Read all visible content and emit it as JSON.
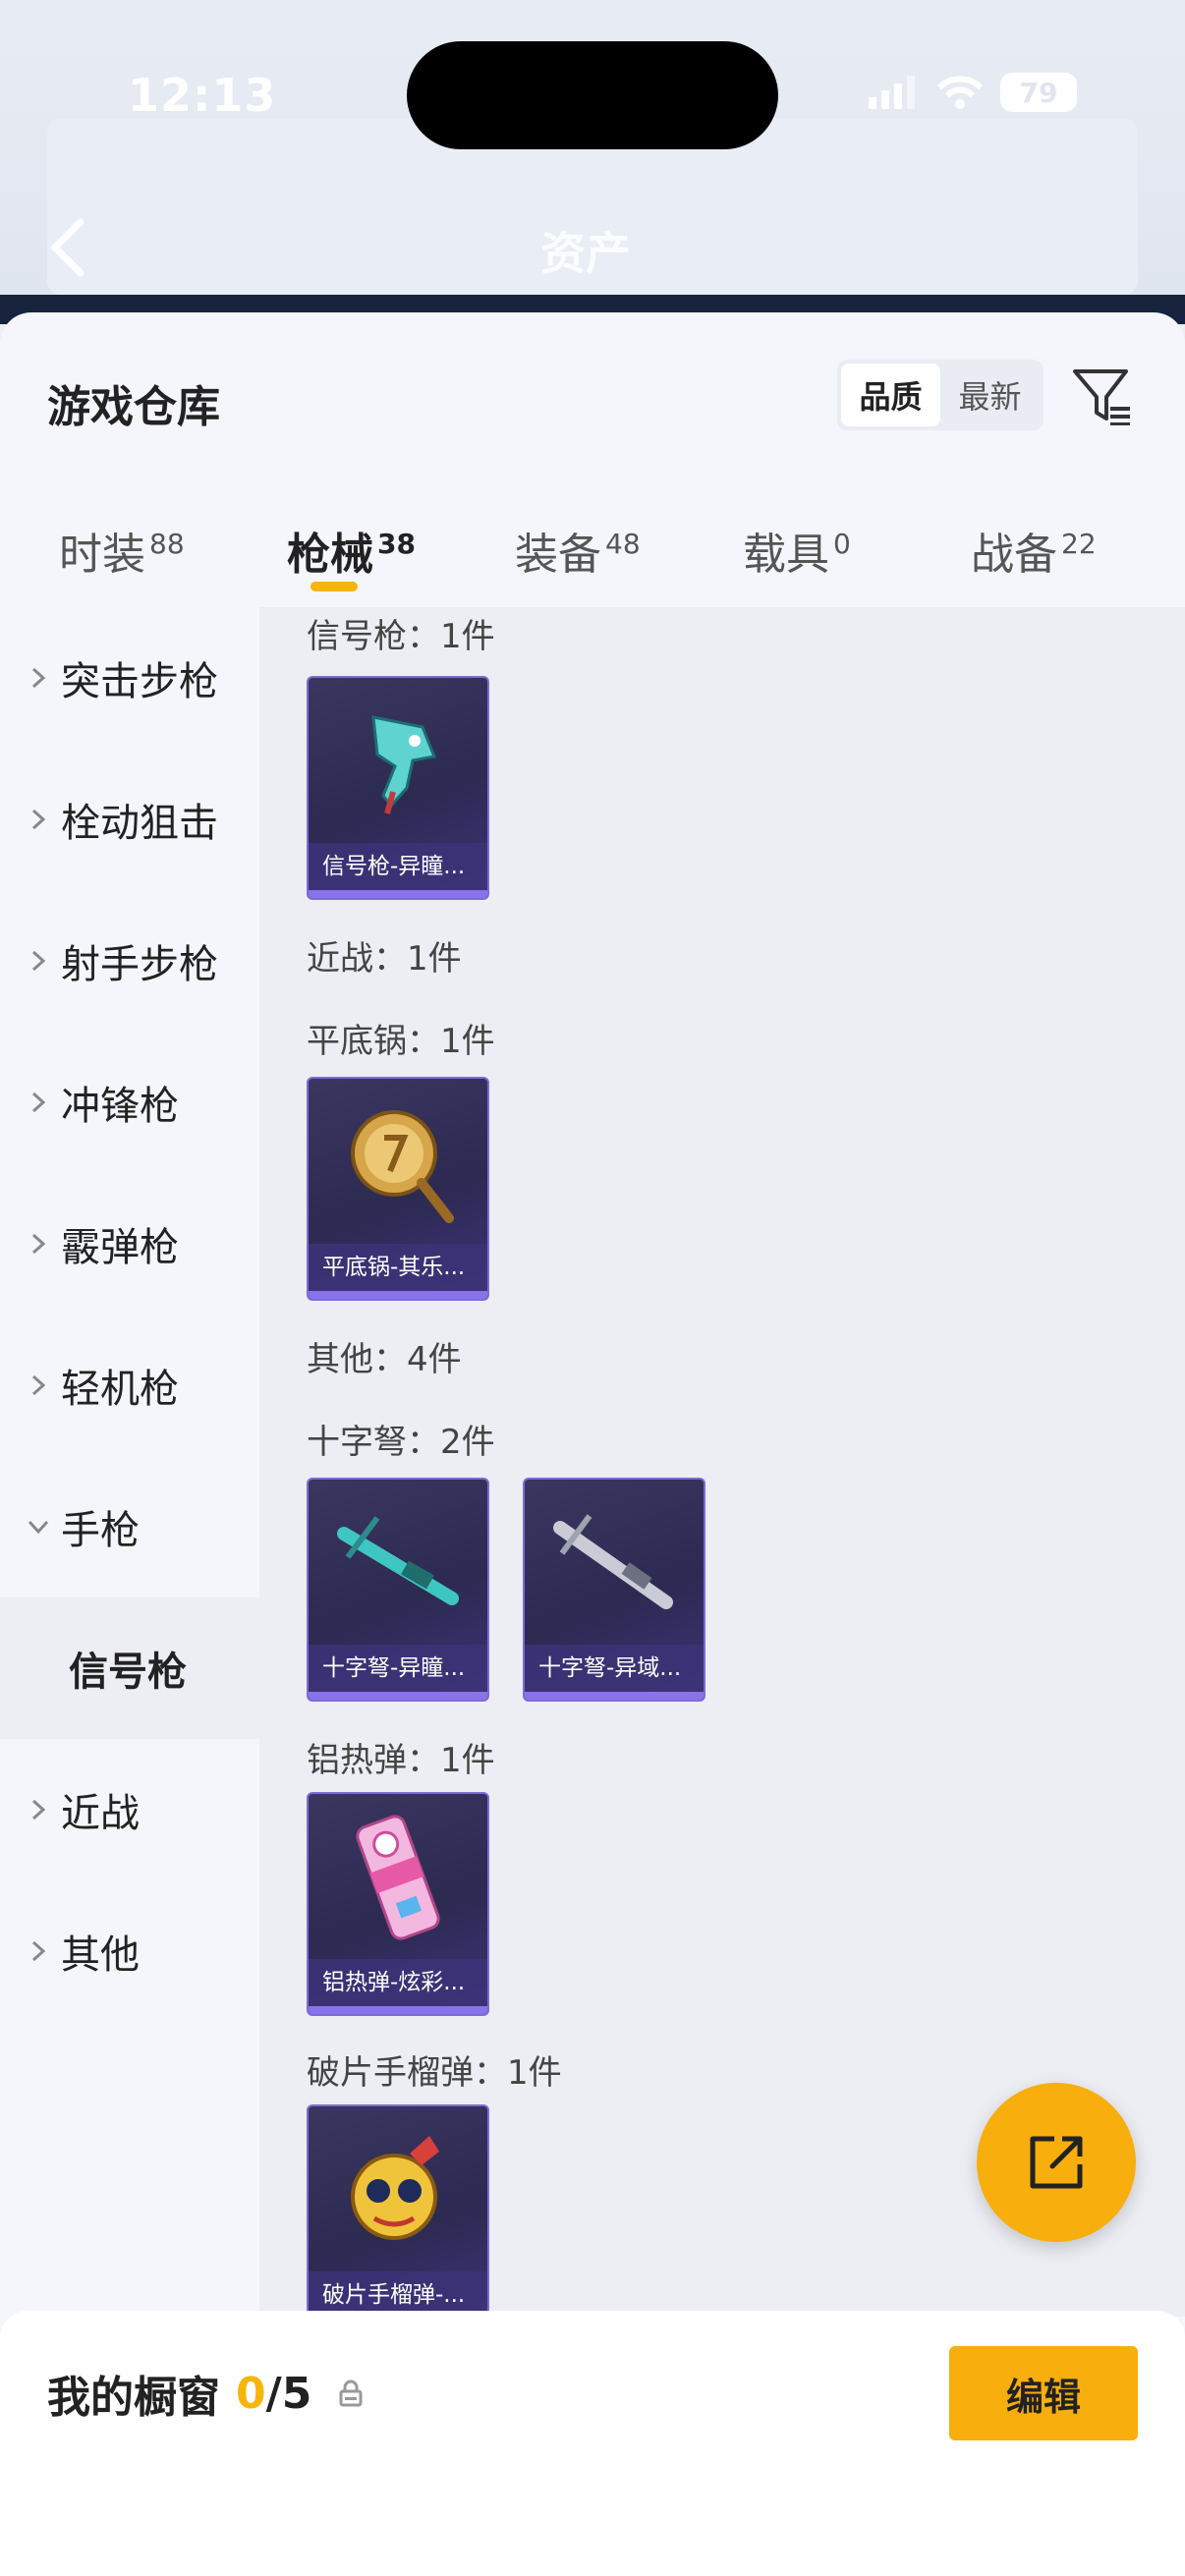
{
  "status_bar": {
    "time": "12:13",
    "battery": "79"
  },
  "header": {
    "title": "资产"
  },
  "panel": {
    "title": "游戏仓库",
    "sort": {
      "quality": "品质",
      "newest": "最新",
      "active": "quality"
    }
  },
  "tabs": [
    {
      "label": "时装",
      "count": "88"
    },
    {
      "label": "枪械",
      "count": "38",
      "active": true
    },
    {
      "label": "装备",
      "count": "48"
    },
    {
      "label": "载具",
      "count": "0"
    },
    {
      "label": "战备",
      "count": "22"
    }
  ],
  "categories": [
    {
      "label": "突击步枪"
    },
    {
      "label": "栓动狙击"
    },
    {
      "label": "射手步枪"
    },
    {
      "label": "冲锋枪"
    },
    {
      "label": "霰弹枪"
    },
    {
      "label": "轻机枪"
    },
    {
      "label": "手枪",
      "expanded": true
    },
    {
      "label": "信号枪",
      "sub": true,
      "selected": true
    },
    {
      "label": "近战"
    },
    {
      "label": "其他"
    }
  ],
  "content": {
    "groups": [
      {
        "label": "信号枪：1件"
      },
      {
        "label": "近战：1件"
      },
      {
        "label": "平底锅：1件"
      },
      {
        "label": "其他：4件"
      },
      {
        "label": "十字弩：2件"
      },
      {
        "label": "铝热弹：1件"
      },
      {
        "label": "破片手榴弹：1件"
      }
    ],
    "items": [
      {
        "name": "信号枪-异瞳...",
        "icon": "flare-gun-icon"
      },
      {
        "name": "平底锅-其乐...",
        "icon": "frying-pan-icon"
      },
      {
        "name": "十字弩-异瞳...",
        "icon": "crossbow-teal-icon"
      },
      {
        "name": "十字弩-异域...",
        "icon": "crossbow-silver-icon"
      },
      {
        "name": "铝热弹-炫彩...",
        "icon": "thermite-icon"
      },
      {
        "name": "破片手榴弹-...",
        "icon": "grenade-icon"
      }
    ]
  },
  "showcase": {
    "label": "我的橱窗",
    "current": "0",
    "total": "/5",
    "edit": "编辑"
  },
  "colors": {
    "accent": "#f8ae0c",
    "card_border": "#7c6cd6"
  }
}
